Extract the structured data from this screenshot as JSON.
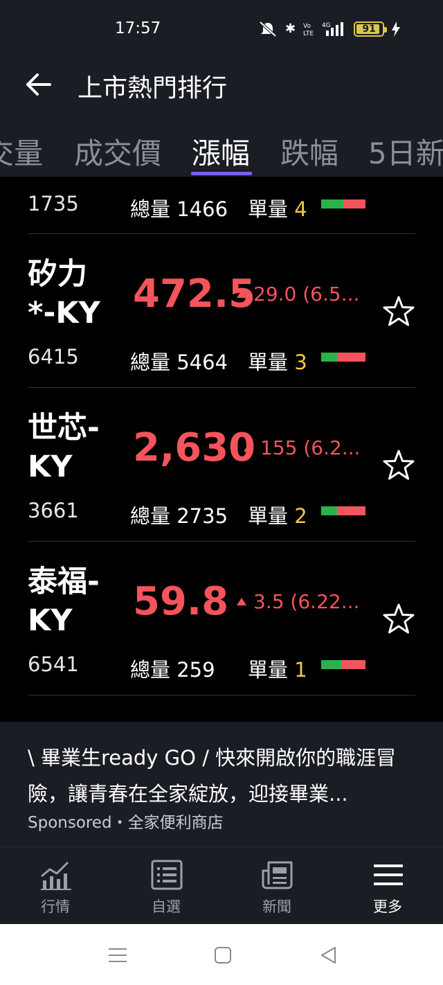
{
  "status_bar": {
    "time": "17:57",
    "icons": [
      "mute-icon",
      "bluetooth-icon",
      "volte-icon",
      "4g-signal-icon"
    ],
    "battery": "91"
  },
  "header": {
    "title": "上市熱門排行"
  },
  "tabs": [
    {
      "label": "交量"
    },
    {
      "label": "成交價"
    },
    {
      "label": "漲幅",
      "active": true
    },
    {
      "label": "跌幅"
    },
    {
      "label": "5日新"
    }
  ],
  "list": {
    "volume_label": "總量",
    "unit_label": "單量",
    "rows": [
      {
        "code": "1735",
        "volume": "1466",
        "unit": "4",
        "buy_ratio": 0.5
      },
      {
        "name_line1": "矽力",
        "name_line2": "*-KY",
        "code": "6415",
        "price": "472.5",
        "change": "29.0 (6.5...",
        "volume": "5464",
        "unit": "3",
        "buy_ratio": 0.36
      },
      {
        "name_line1": "世芯-",
        "name_line2": "KY",
        "code": "3661",
        "price": "2,630",
        "change": "155 (6.2...",
        "volume": "2735",
        "unit": "2",
        "buy_ratio": 0.36
      },
      {
        "name_line1": "泰福-",
        "name_line2": "KY",
        "code": "6541",
        "price": "59.8",
        "change": "3.5 (6.22...",
        "volume": "259",
        "unit": "1",
        "buy_ratio": 0.45
      }
    ]
  },
  "ad": {
    "text": "\\ 畢業生ready GO / 快來開啟你的職涯冒險，讓青春在全家綻放，迎接畢業...",
    "sponsor": "Sponsored・全家便利商店"
  },
  "bottom_nav": [
    {
      "label": "行情",
      "icon": "chart-icon"
    },
    {
      "label": "自選",
      "icon": "list-icon"
    },
    {
      "label": "新聞",
      "icon": "news-icon"
    },
    {
      "label": "更多",
      "icon": "menu-icon",
      "active": true
    }
  ],
  "colors": {
    "up": "#f4545b",
    "buy": "#2bb24c",
    "accent": "#7b5cf5",
    "unit_value": "#f5c842"
  }
}
